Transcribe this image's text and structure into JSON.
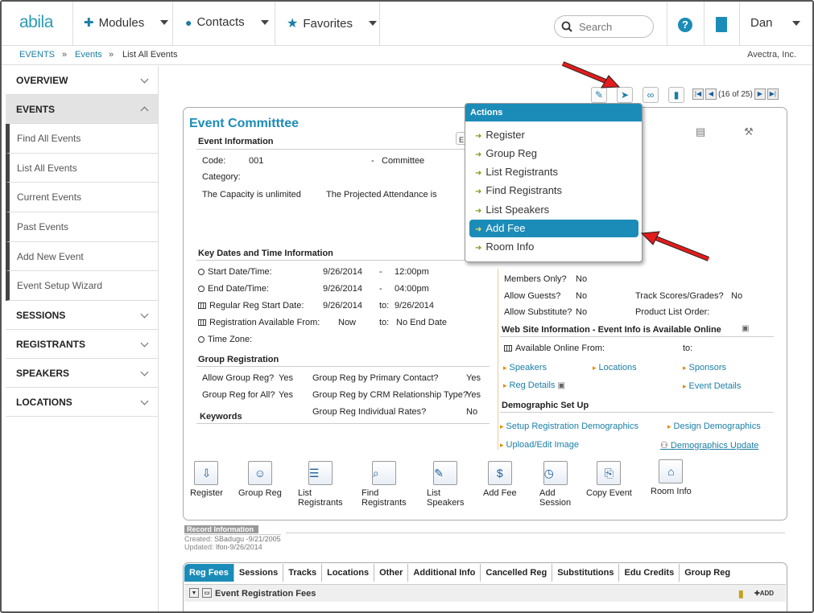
{
  "nav": {
    "logo": "abila",
    "modules": "Modules",
    "contacts": "Contacts",
    "favorites": "Favorites",
    "search_placeholder": "Search",
    "help": "?",
    "user": "Dan"
  },
  "breadcrumb": {
    "root": "EVENTS",
    "sep1": "»",
    "events": "Events",
    "sep2": "»",
    "current": "List All Events",
    "company": "Avectra, Inc."
  },
  "sidebar": {
    "overview": "OVERVIEW",
    "events": "EVENTS",
    "items": [
      "Find All Events",
      "List All Events",
      "Current Events",
      "Past Events",
      "Add New Event",
      "Event Setup Wizard"
    ],
    "sessions": "SESSIONS",
    "registrants": "REGISTRANTS",
    "speakers": "SPEAKERS",
    "locations": "LOCATIONS"
  },
  "pager": {
    "text": "(16 of 25)"
  },
  "panel": {
    "title": "Event Committtee",
    "event_info": "Event Information",
    "code_label": "Code:",
    "code_value": "001",
    "dash": "-",
    "type_value": "Committee",
    "category_label": "Category:",
    "capacity": "The Capacity is unlimited",
    "projected": "The Projected Attendance is",
    "key_dates": "Key Dates and Time Information",
    "dates": [
      {
        "label": "Start Date/Time:",
        "date": "9/26/2014",
        "sep": "-",
        "value": "12:00pm"
      },
      {
        "label": "End Date/Time:",
        "date": "9/26/2014",
        "sep": "-",
        "value": "04:00pm"
      },
      {
        "label": "Regular Reg Start Date:",
        "date": "9/26/2014",
        "sep": "to:",
        "value": "9/26/2014"
      },
      {
        "label": "Registration Available From:",
        "date": "Now",
        "sep": "to:",
        "value": "No End Date"
      },
      {
        "label": "Time Zone:",
        "date": "",
        "sep": "",
        "value": ""
      }
    ],
    "group_reg": "Group Registration",
    "allow_group": "Allow Group Reg?",
    "allow_group_v": "Yes",
    "by_primary": "Group Reg by Primary Contact?",
    "by_primary_v": "Yes",
    "reg_for_all": "Group Reg for All?",
    "reg_for_all_v": "Yes",
    "by_crm": "Group Reg by CRM Relationship Type?",
    "by_crm_v": "Yes",
    "keywords": "Keywords",
    "indiv_rates": "Group Reg Individual Rates?",
    "indiv_rates_v": "No",
    "members_only": "Members Only?",
    "members_only_v": "No",
    "allow_guests": "Allow Guests?",
    "allow_guests_v": "No",
    "track_scores": "Track Scores/Grades?",
    "track_scores_v": "No",
    "allow_sub": "Allow Substitute?",
    "allow_sub_v": "No",
    "product_order": "Product List Order:",
    "website_info": "Web Site Information - Event Info is Available Online",
    "available_from": "Available Online From:",
    "available_to": "to:",
    "links": [
      "Speakers",
      "Locations",
      "Sponsors",
      "Reg Details",
      "Event Details"
    ],
    "demographic": "Demographic Set Up",
    "demo_links": [
      "Setup Registration Demographics",
      "Design Demographics",
      "Upload/Edit Image",
      "Demographics Update"
    ],
    "buttons": [
      {
        "label1": "Register",
        "label2": ""
      },
      {
        "label1": "Group Reg",
        "label2": ""
      },
      {
        "label1": "List",
        "label2": "Registrants"
      },
      {
        "label1": "Find",
        "label2": "Registrants"
      },
      {
        "label1": "List",
        "label2": "Speakers"
      },
      {
        "label1": "Add Fee",
        "label2": ""
      },
      {
        "label1": "Add",
        "label2": "Session"
      },
      {
        "label1": "Copy Event",
        "label2": ""
      },
      {
        "label1": "Room Info",
        "label2": ""
      }
    ]
  },
  "record": {
    "header": "Record Information",
    "created": "Created:",
    "created_v": "SBadugu -9/21/2005",
    "updated": "Updated:",
    "updated_v": "lfon-9/26/2014"
  },
  "tabs": [
    "Reg Fees",
    "Sessions",
    "Tracks",
    "Locations",
    "Other",
    "Additional Info",
    "Cancelled Reg",
    "Substitutions",
    "Edu Credits",
    "Group Reg"
  ],
  "fees_header": "Event Registration Fees",
  "add_label": "ADD",
  "actions": {
    "header": "Actions",
    "items": [
      "Register",
      "Group Reg",
      "List Registrants",
      "Find Registrants",
      "List Speakers",
      "Add Fee",
      "Room Info"
    ],
    "selected_index": 5
  },
  "colors": {
    "accent": "#1b8cb8",
    "arrow": "#e31b1b"
  }
}
